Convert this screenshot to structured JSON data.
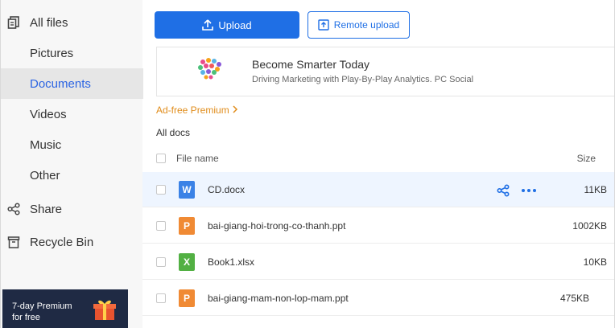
{
  "sidebar": {
    "items": [
      {
        "label": "All files",
        "icon": "all-files-icon"
      },
      {
        "label": "Pictures"
      },
      {
        "label": "Documents",
        "active": true
      },
      {
        "label": "Videos"
      },
      {
        "label": "Music"
      },
      {
        "label": "Other"
      },
      {
        "label": "Share",
        "icon": "share-icon"
      },
      {
        "label": "Recycle Bin",
        "icon": "recycle-bin-icon"
      }
    ],
    "promo": {
      "line1": "7-day Premium",
      "line2": "for free",
      "icon": "gift-icon"
    }
  },
  "toolbar": {
    "upload_label": "Upload",
    "remote_upload_label": "Remote upload"
  },
  "ad": {
    "title": "Become Smarter Today",
    "subtitle": "Driving Marketing with Play-By-Play Analytics. PC Social"
  },
  "premium_link": "Ad-free Premium",
  "section_title": "All docs",
  "table": {
    "columns": {
      "name": "File name",
      "size": "Size"
    },
    "rows": [
      {
        "name": "CD.docx",
        "size": "11KB",
        "type_letter": "W",
        "color": "#3b82e6"
      },
      {
        "name": "bai-giang-hoi-trong-co-thanh.ppt",
        "size": "1002KB",
        "type_letter": "P",
        "color": "#f08a34"
      },
      {
        "name": "Book1.xlsx",
        "size": "10KB",
        "type_letter": "X",
        "color": "#52b043"
      },
      {
        "name": "bai-giang-mam-non-lop-mam.ppt",
        "size": "475KB",
        "type_letter": "P",
        "color": "#f08a34"
      }
    ]
  },
  "colors": {
    "accent": "#1f6fe5",
    "premium": "#e08c1a"
  }
}
